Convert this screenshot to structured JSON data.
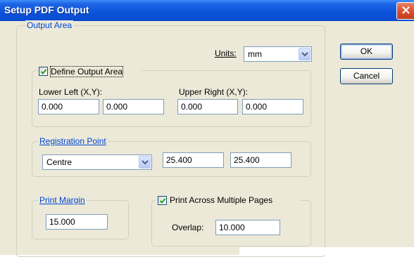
{
  "window": {
    "title": "Setup PDF Output",
    "close_glyph": "×"
  },
  "output_area": {
    "legend": "Output Area",
    "units_label": "Units:",
    "units_value": "mm",
    "define": {
      "label": "Define Output Area",
      "checked": true,
      "lower_left_label": "Lower Left (X,Y):",
      "lower_left_x": "0.000",
      "lower_left_y": "0.000",
      "upper_right_label": "Upper Right (X,Y):",
      "upper_right_x": "0.000",
      "upper_right_y": "0.000"
    },
    "registration": {
      "legend": "Registration Point",
      "value": "Centre",
      "x": "25.400",
      "y": "25.400"
    },
    "print_margin": {
      "legend": "Print Margin",
      "value": "15.000"
    },
    "multiple_pages": {
      "label": "Print Across Multiple Pages",
      "checked": true,
      "overlap_label": "Overlap:",
      "overlap_value": "10.000"
    }
  },
  "buttons": {
    "ok": "OK",
    "cancel": "Cancel"
  },
  "colors": {
    "title_bar": "#0a52d8",
    "dialog_bg": "#ece9d8",
    "accent_text": "#0046d5",
    "close": "#d9512f"
  }
}
